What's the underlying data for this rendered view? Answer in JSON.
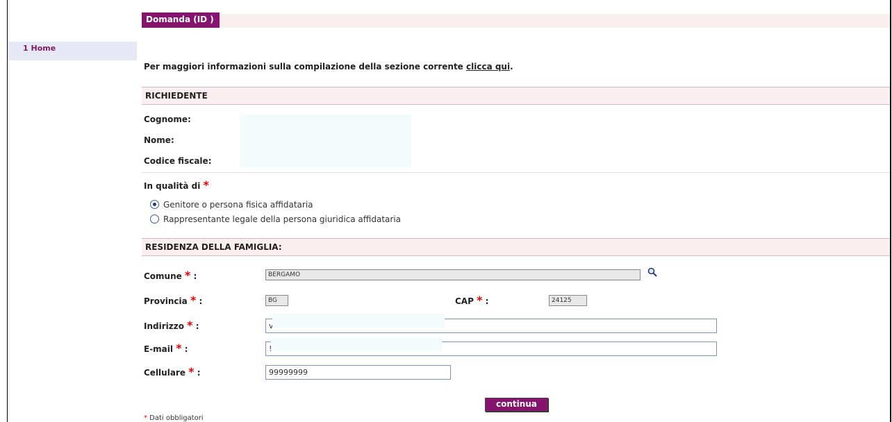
{
  "window": {
    "title": "Domanda (ID )"
  },
  "sidebar": {
    "items": [
      {
        "label": "1 Home"
      }
    ]
  },
  "info": {
    "text": "Per maggiori informazioni sulla compilazione della sezione corrente ",
    "link": "clicca qui",
    "suffix": "."
  },
  "richiedente": {
    "header": "RICHIEDENTE",
    "cognome_label": "Cognome",
    "nome_label": "Nome",
    "cf_label": "Codice fiscale",
    "colon": ":"
  },
  "qualita": {
    "label": "In qualità di",
    "required_mark": "*",
    "options": [
      {
        "label": "Genitore o persona fisica affidataria",
        "checked": true
      },
      {
        "label": "Rappresentante legale della persona giuridica affidataria",
        "checked": false
      }
    ]
  },
  "residenza": {
    "header": "RESIDENZA DELLA FAMIGLIA",
    "colon": ":",
    "comune": {
      "label": "Comune",
      "value": "BERGAMO"
    },
    "provincia": {
      "label": "Provincia",
      "value": "BG"
    },
    "cap": {
      "label": "CAP",
      "value": "24125"
    },
    "indirizzo": {
      "label": "Indirizzo",
      "value": "v"
    },
    "email": {
      "label": "E-mail",
      "value": "!"
    },
    "cellulare": {
      "label": "Cellulare",
      "value": "99999999"
    },
    "required_mark": "*",
    "sep": " :"
  },
  "actions": {
    "continue_label": "continua"
  },
  "footnote": {
    "star": "*",
    "text": " Dati obbligatori"
  },
  "colors": {
    "accent": "#86136d",
    "section_bg": "#fbeef1",
    "required": "#ee0000"
  },
  "icons": {
    "search": "magnifier-icon"
  }
}
